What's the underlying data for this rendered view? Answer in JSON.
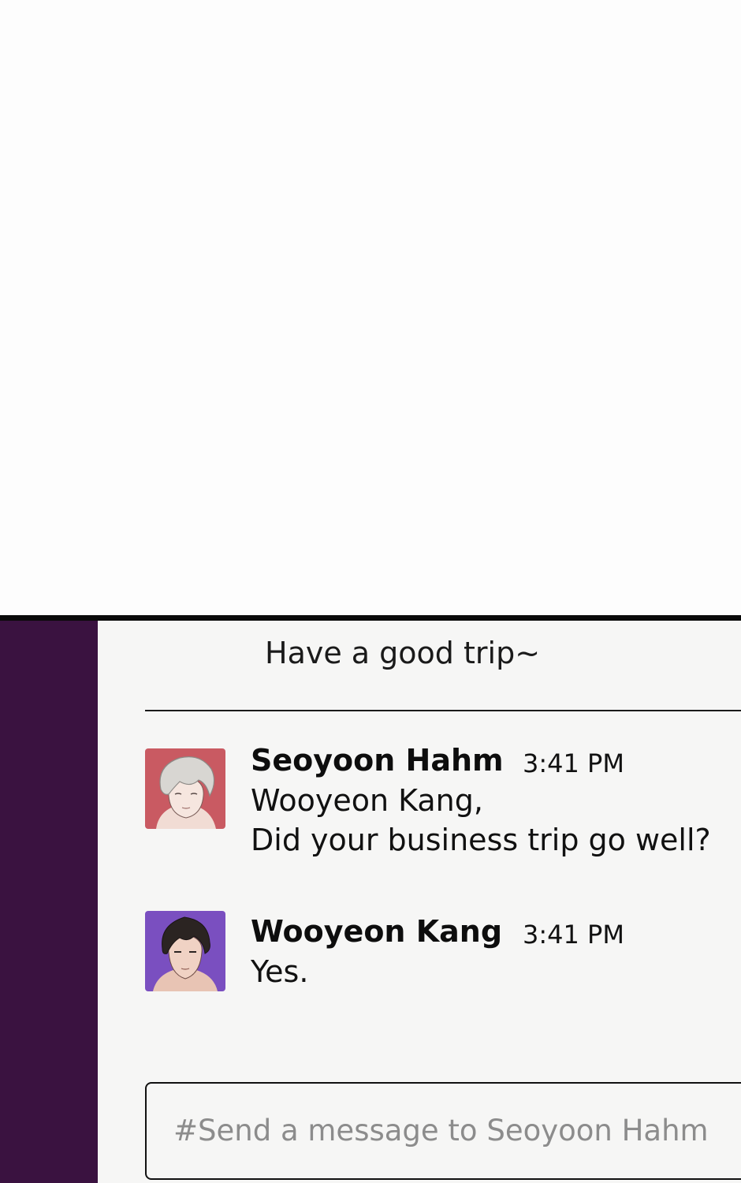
{
  "previous_message": {
    "text": "Have a good trip~"
  },
  "messages": [
    {
      "sender": "Seoyoon Hahm",
      "time": "3:41 PM",
      "lines": [
        "Wooyeon Kang,",
        "Did your business trip go well?"
      ],
      "avatar_icon": "avatar-seoyoon",
      "avatar_color": "#c95a62"
    },
    {
      "sender": "Wooyeon Kang",
      "time": "3:41 PM",
      "lines": [
        "Yes."
      ],
      "avatar_icon": "avatar-wooyeon",
      "avatar_color": "#7a4fc0"
    }
  ],
  "composer": {
    "placeholder": "#Send a message to Seoyoon Hahm",
    "value": ""
  },
  "colors": {
    "sidebar": "#3a1240",
    "chat_background": "#f6f6f5"
  }
}
